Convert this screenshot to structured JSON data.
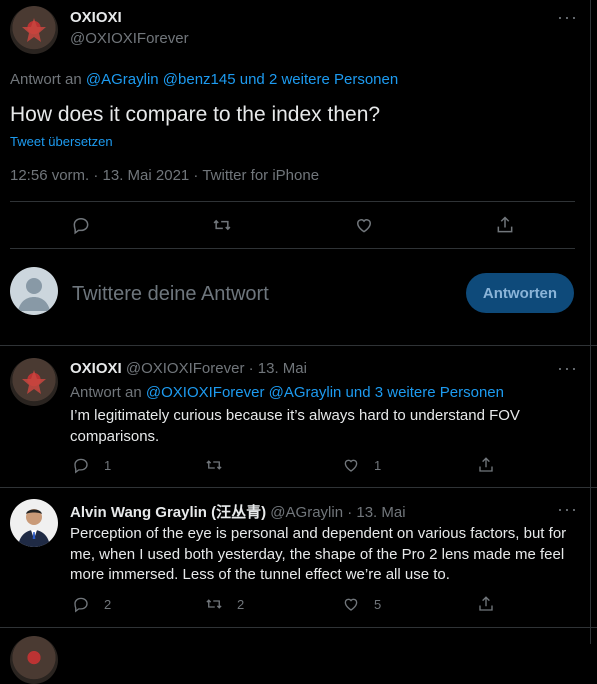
{
  "main_tweet": {
    "display_name": "OXIOXI",
    "handle": "@OXIOXIForever",
    "reply_prefix": "Antwort an",
    "reply_to": "@AGraylin @benz145 und 2 weitere Personen",
    "text": "How does it compare to the index then?",
    "translate": "Tweet übersetzen",
    "meta": "12:56 vorm. · 13. Mai 2021 · Twitter for iPhone"
  },
  "compose": {
    "placeholder": "Twittere deine Antwort",
    "button": "Antworten"
  },
  "replies": [
    {
      "display_name": "OXIOXI",
      "handle_time": "@OXIOXIForever · 13. Mai",
      "reply_prefix": "Antwort an",
      "reply_to": "@OXIOXIForever @AGraylin und 3 weitere Personen",
      "text": "I’m legitimately curious because it’s always hard to understand FOV comparisons.",
      "reply_count": "1",
      "retweet_count": "",
      "like_count": "1"
    },
    {
      "display_name": "Alvin Wang Graylin (汪丛青)",
      "handle_time": "@AGraylin · 13. Mai",
      "text": "Perception of the eye is personal and dependent on various factors, but for me, when I used both yesterday, the shape of the Pro 2 lens made me feel more immersed. Less of the tunnel effect we’re all use to.",
      "reply_count": "2",
      "retweet_count": "2",
      "like_count": "5"
    }
  ],
  "colors": {
    "accent": "#1d9bf0",
    "muted": "#71767b",
    "divider": "#2f3336"
  }
}
